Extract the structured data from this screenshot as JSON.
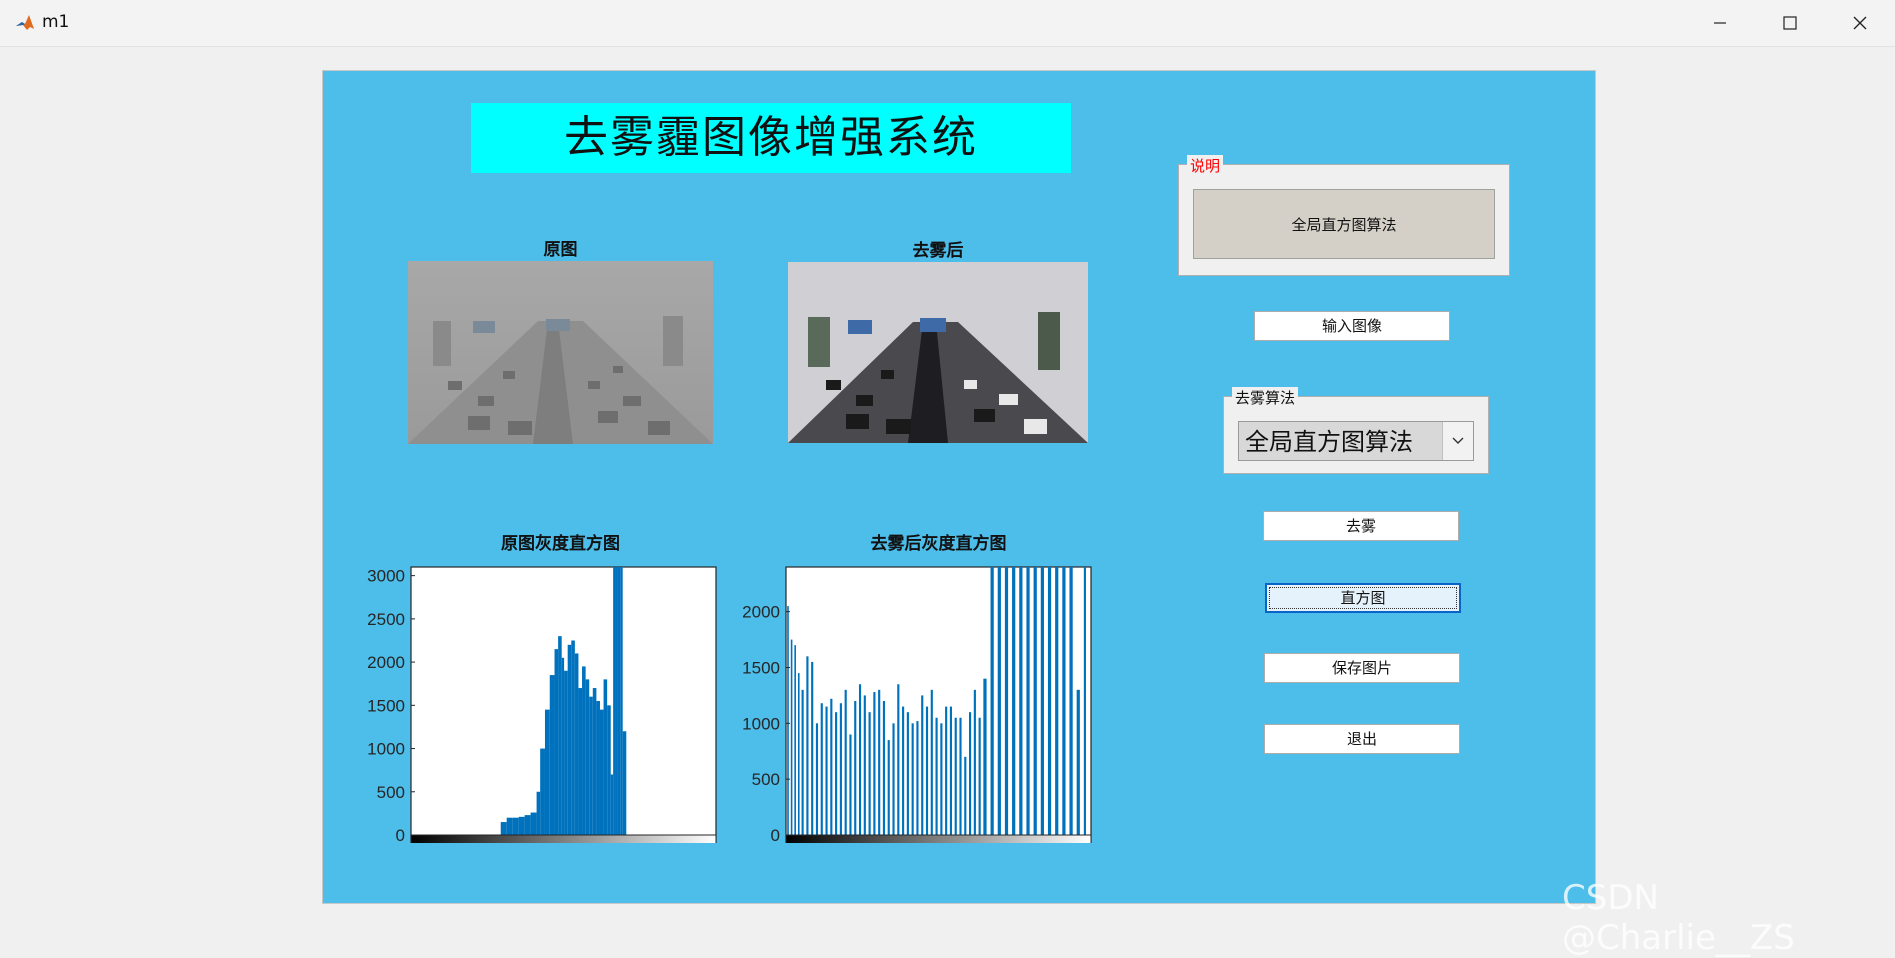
{
  "window": {
    "title": "m1"
  },
  "header": {
    "title": "去雾霾图像增强系统"
  },
  "images": {
    "original_title": "原图",
    "dehazed_title": "去雾后"
  },
  "histograms": {
    "original_title": "原图灰度直方图",
    "dehazed_title": "去雾后灰度直方图"
  },
  "description_panel": {
    "title": "说明",
    "text": "全局直方图算法"
  },
  "algorithm_panel": {
    "title": "去雾算法",
    "selected": "全局直方图算法"
  },
  "buttons": {
    "input_image": "输入图像",
    "dehaze": "去雾",
    "histogram": "直方图",
    "save_image": "保存图片",
    "exit": "退出"
  },
  "watermark": "CSDN @Charlie__ZS",
  "colors": {
    "figure_bg": "#4dbdea",
    "title_bg": "#00ffff",
    "bar": "#0072bd",
    "panel_title": "#ff0000"
  },
  "chart_data": [
    {
      "type": "bar",
      "title": "原图灰度直方图",
      "xlim": [
        0,
        255
      ],
      "ylim": [
        0,
        3100
      ],
      "xticks": [
        0,
        50,
        100,
        150,
        200,
        250
      ],
      "yticks": [
        0,
        500,
        1000,
        1500,
        2000,
        2500,
        3000
      ],
      "x": [
        0,
        70,
        75,
        80,
        85,
        90,
        95,
        100,
        105,
        108,
        112,
        116,
        120,
        123,
        126,
        128,
        131,
        134,
        137,
        140,
        143,
        146,
        149,
        152,
        155,
        158,
        161,
        164,
        167,
        169,
        171,
        173,
        175,
        177,
        180,
        190,
        255
      ],
      "values": [
        0,
        0,
        150,
        200,
        200,
        210,
        230,
        260,
        500,
        1000,
        1450,
        1850,
        2150,
        2300,
        2050,
        1900,
        2200,
        2250,
        2100,
        1700,
        1950,
        1800,
        1600,
        1700,
        1550,
        1450,
        1800,
        1500,
        700,
        3100,
        3100,
        3100,
        3100,
        1200,
        0,
        0,
        0
      ]
    },
    {
      "type": "bar",
      "title": "去雾后灰度直方图",
      "xlim": [
        0,
        255
      ],
      "ylim": [
        0,
        2400
      ],
      "xticks": [
        0,
        50,
        100,
        150,
        200,
        250
      ],
      "yticks": [
        0,
        500,
        1000,
        1500,
        2000
      ],
      "x": [
        1,
        4,
        7,
        10,
        13,
        17,
        21,
        25,
        29,
        33,
        37,
        41,
        45,
        49,
        53,
        57,
        61,
        65,
        69,
        73,
        77,
        81,
        85,
        89,
        93,
        97,
        101,
        105,
        109,
        113,
        117,
        121,
        125,
        129,
        133,
        137,
        141,
        145,
        149,
        153,
        157,
        161,
        165,
        171,
        177,
        183,
        189,
        195,
        201,
        207,
        213,
        219,
        225,
        231,
        237,
        243,
        249,
        253
      ],
      "values": [
        2050,
        1750,
        1700,
        1450,
        1300,
        1600,
        1550,
        1000,
        1180,
        1150,
        1220,
        1100,
        1180,
        1300,
        900,
        1200,
        1350,
        1250,
        1100,
        1280,
        1300,
        1200,
        850,
        1000,
        1350,
        1150,
        1100,
        1000,
        1020,
        1250,
        1150,
        1300,
        1050,
        1000,
        1150,
        1150,
        1050,
        1050,
        700,
        1100,
        1300,
        1050,
        1400,
        2400,
        2400,
        2400,
        2400,
        2400,
        2400,
        2400,
        2400,
        2400,
        2400,
        2400,
        2400,
        1300,
        2400,
        900
      ]
    }
  ]
}
